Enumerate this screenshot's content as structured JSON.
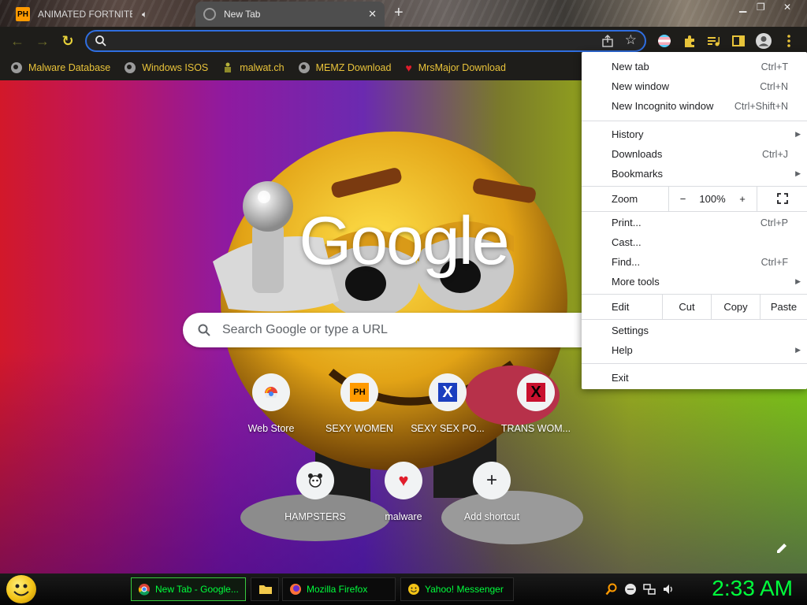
{
  "tabs": [
    {
      "title": "ANIMATED FORTNITE",
      "favicon": "PH",
      "audio": "speaker-muted-icon"
    },
    {
      "title": "New Tab",
      "favicon": "chrome-globe-icon"
    }
  ],
  "omnibox": {
    "placeholder": ""
  },
  "bookmarks": [
    {
      "label": "Malware Database",
      "icon": "globe-icon"
    },
    {
      "label": "Windows ISOS",
      "icon": "globe-icon"
    },
    {
      "label": "malwat.ch",
      "icon": "figure-icon"
    },
    {
      "label": "MEMZ Download",
      "icon": "globe-icon"
    },
    {
      "label": "MrsMajor Download",
      "icon": "heart-icon"
    }
  ],
  "ntp": {
    "logo": "Google",
    "search_placeholder": "Search Google or type a URL",
    "shortcuts": [
      {
        "label": "Web Store",
        "icon": "webstore-icon"
      },
      {
        "label": "SEXY WOMEN",
        "icon": "PH"
      },
      {
        "label": "SEXY SEX PO...",
        "icon": "x-blue-icon"
      },
      {
        "label": "TRANS WOM...",
        "icon": "x-red-icon"
      },
      {
        "label": "HAMPSTERS",
        "icon": "hamster-icon"
      },
      {
        "label": "malware",
        "icon": "heart-icon"
      },
      {
        "label": "Add shortcut",
        "icon": "plus-icon"
      }
    ]
  },
  "menu": {
    "new_tab": "New tab",
    "new_tab_sc": "Ctrl+T",
    "new_window": "New window",
    "new_window_sc": "Ctrl+N",
    "new_incognito": "New Incognito window",
    "new_incognito_sc": "Ctrl+Shift+N",
    "history": "History",
    "downloads": "Downloads",
    "downloads_sc": "Ctrl+J",
    "bookmarks": "Bookmarks",
    "zoom": "Zoom",
    "zoom_minus": "−",
    "zoom_level": "100%",
    "zoom_plus": "+",
    "print": "Print...",
    "print_sc": "Ctrl+P",
    "cast": "Cast...",
    "find": "Find...",
    "find_sc": "Ctrl+F",
    "more_tools": "More tools",
    "edit": "Edit",
    "cut": "Cut",
    "copy": "Copy",
    "paste": "Paste",
    "settings": "Settings",
    "help": "Help",
    "exit": "Exit"
  },
  "taskbar": {
    "tasks": [
      {
        "label": "New Tab - Google...",
        "icon": "chrome-icon"
      },
      {
        "label": "",
        "icon": "folder-icon"
      },
      {
        "label": "Mozilla Firefox",
        "icon": "firefox-icon"
      },
      {
        "label": "Yahoo! Messenger",
        "icon": "smiley-icon"
      }
    ],
    "clock": "2:33 AM"
  },
  "colors": {
    "accent": "#2f6ee0",
    "bookmark_text": "#e9c33a",
    "taskbar_text": "#00ff3c"
  }
}
